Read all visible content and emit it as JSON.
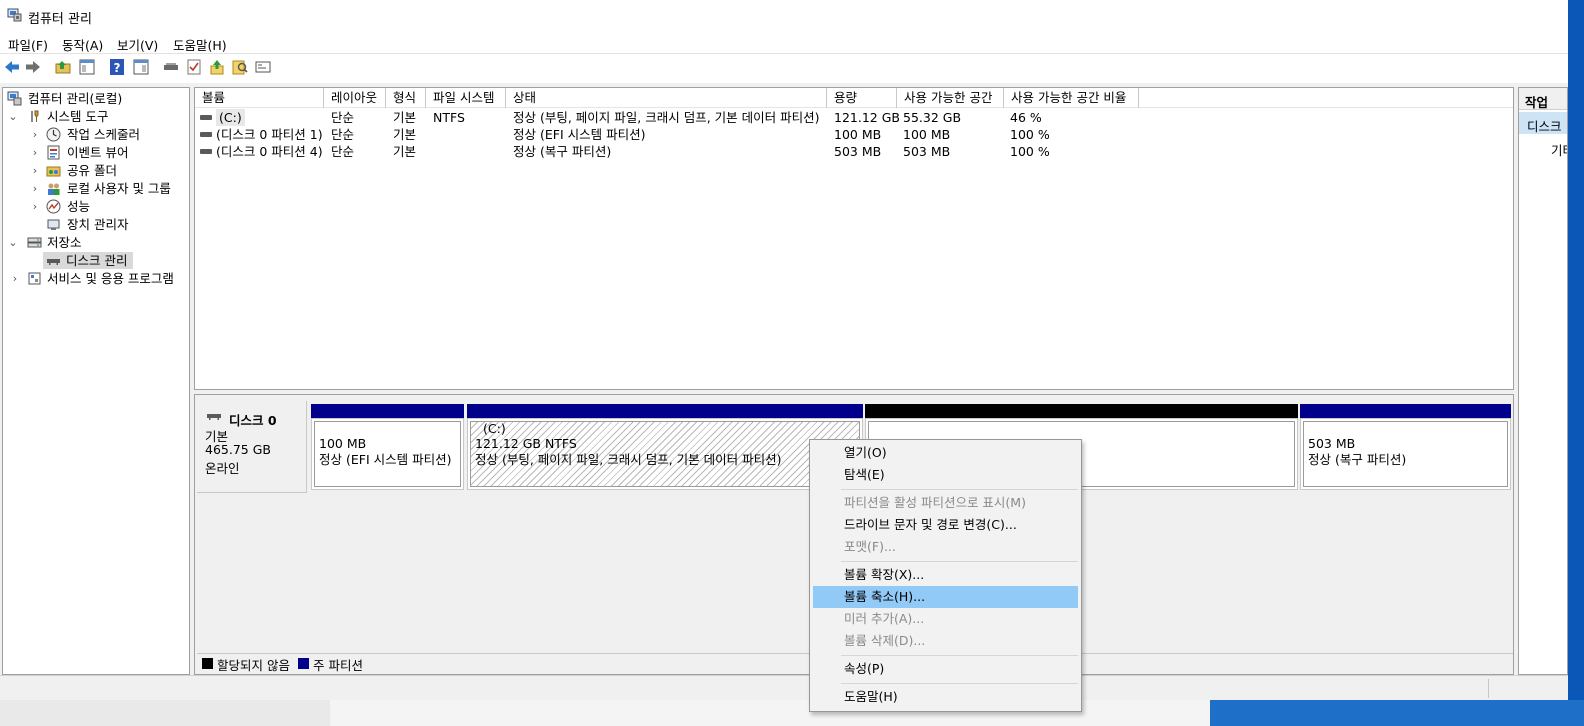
{
  "window": {
    "title": "컴퓨터 관리"
  },
  "menubar": [
    "파일(F)",
    "동작(A)",
    "보기(V)",
    "도움말(H)"
  ],
  "toolbar": {
    "icons": [
      "back-arrow-icon",
      "forward-arrow-icon",
      "up-folder-icon",
      "show-hide-tree-icon",
      "help-icon",
      "properties-panel-icon",
      "connect-drive-icon",
      "check-icon",
      "export-icon",
      "search-icon",
      "console-icon"
    ]
  },
  "tree": {
    "root": "컴퓨터 관리(로컬)",
    "system_tools": "시스템 도구",
    "task_scheduler": "작업 스케줄러",
    "event_viewer": "이벤트 뷰어",
    "shared_folders": "공유 폴더",
    "local_users": "로컬 사용자 및 그룹",
    "performance": "성능",
    "device_manager": "장치 관리자",
    "storage": "저장소",
    "disk_management": "디스크 관리",
    "services_apps": "서비스 및 응용 프로그램"
  },
  "volume_table": {
    "columns": [
      "볼륨",
      "레이아웃",
      "형식",
      "파일 시스템",
      "상태",
      "용량",
      "사용 가능한 공간",
      "사용 가능한 공간 비율"
    ],
    "rows": [
      {
        "volume": "(C:)",
        "layout": "단순",
        "type": "기본",
        "fs": "NTFS",
        "status": "정상 (부팅, 페이지 파일, 크래시 덤프, 기본 데이터 파티션)",
        "capacity": "121.12 GB",
        "free": "55.32 GB",
        "pct": "46 %"
      },
      {
        "volume": "(디스크 0 파티션 1)",
        "layout": "단순",
        "type": "기본",
        "fs": "",
        "status": "정상 (EFI 시스템 파티션)",
        "capacity": "100 MB",
        "free": "100 MB",
        "pct": "100 %"
      },
      {
        "volume": "(디스크 0 파티션 4)",
        "layout": "단순",
        "type": "기본",
        "fs": "",
        "status": "정상 (복구 파티션)",
        "capacity": "503 MB",
        "free": "503 MB",
        "pct": "100 %"
      }
    ]
  },
  "disk": {
    "name": "디스크 0",
    "type": "기본",
    "size": "465.75 GB",
    "state": "온라인",
    "partitions": [
      {
        "label": "",
        "size": "100 MB",
        "status": "정상 (EFI 시스템 파티션)",
        "bar_color": "#00008b"
      },
      {
        "label": "(C:)",
        "size": "121.12 GB NTFS",
        "status": "정상 (부팅, 페이지 파일, 크래시 덤프, 기본 데이터 파티션)",
        "bar_color": "#00008b"
      },
      {
        "label": "",
        "size": "",
        "status": "",
        "bar_color": "#000000"
      },
      {
        "label": "",
        "size": "503 MB",
        "status": "정상 (복구 파티션)",
        "bar_color": "#00008b"
      }
    ]
  },
  "legend": [
    {
      "label": "할당되지 않음",
      "color": "#000000"
    },
    {
      "label": "주 파티션",
      "color": "#00008b"
    }
  ],
  "actions": {
    "title": "작업",
    "item": "디스크",
    "sub": "기타"
  },
  "context_menu": {
    "open": "열기(O)",
    "explore": "탐색(E)",
    "mark_active": "파티션을 활성 파티션으로 표시(M)",
    "change_letter": "드라이브 문자 및 경로 변경(C)...",
    "format": "포맷(F)...",
    "extend": "볼륨 확장(X)...",
    "shrink": "볼륨 축소(H)...",
    "add_mirror": "미러 추가(A)...",
    "delete": "볼륨 삭제(D)...",
    "properties": "속성(P)",
    "help": "도움말(H)"
  },
  "colors": {
    "primary_partition": "#00008b",
    "unallocated": "#000000",
    "highlight": "#91c9f7"
  }
}
